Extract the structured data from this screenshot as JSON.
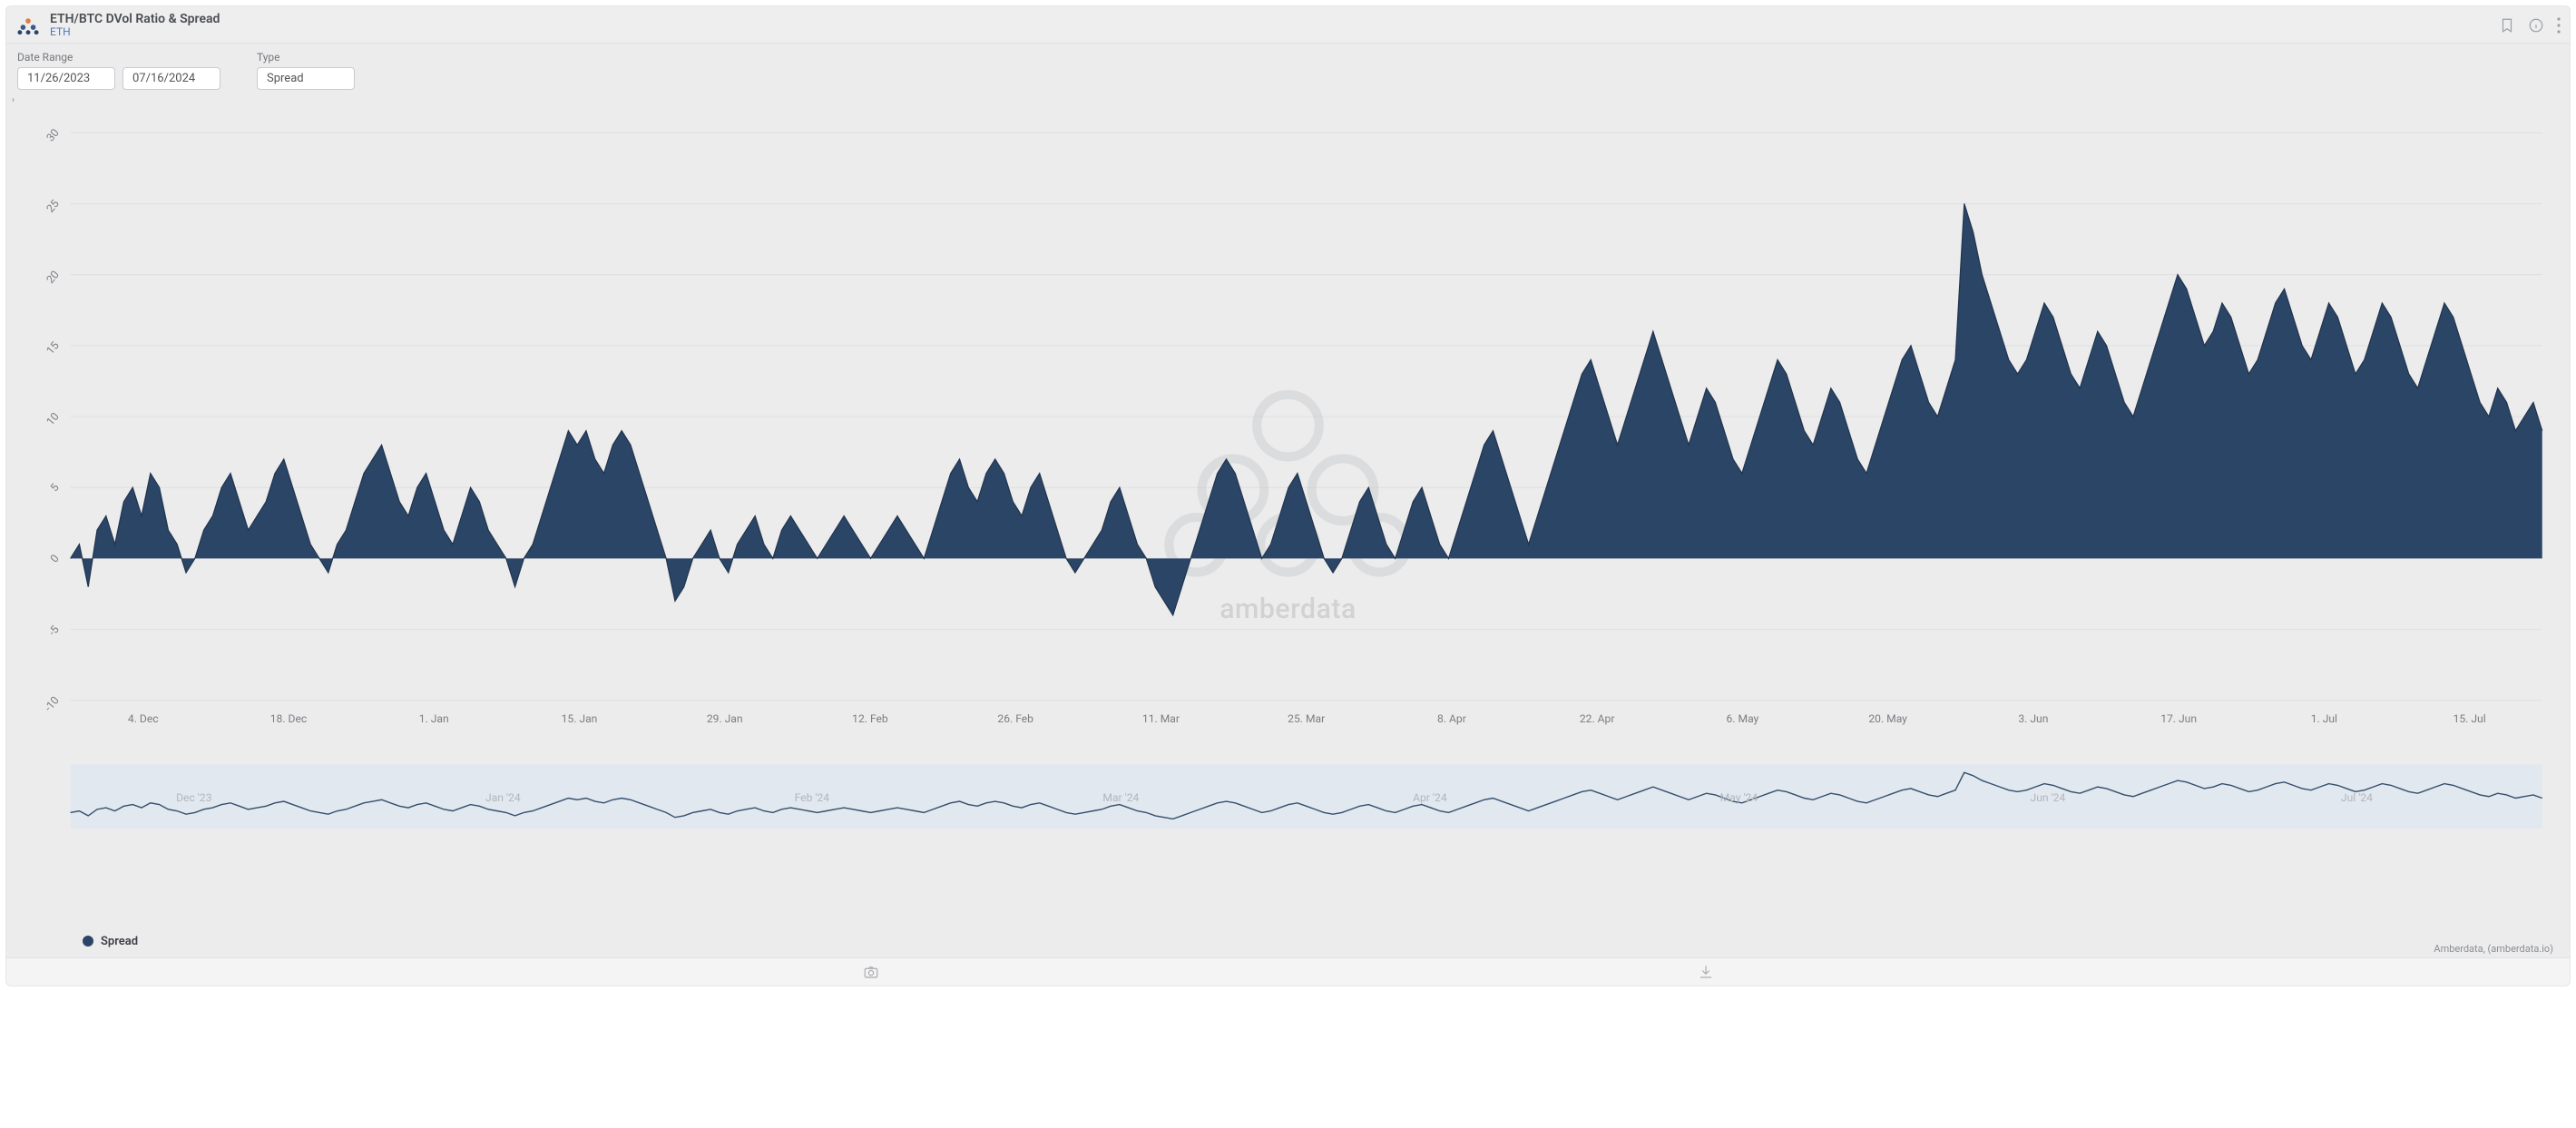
{
  "header": {
    "title": "ETH/BTC DVol Ratio & Spread",
    "subtitle": "ETH"
  },
  "controls": {
    "date_range_label": "Date Range",
    "date_start": "11/26/2023",
    "date_end": "07/16/2024",
    "type_label": "Type",
    "type_value": "Spread"
  },
  "legend": {
    "series_name": "Spread"
  },
  "credit": "Amberdata, (amberdata.io)",
  "watermark": "amberdata",
  "chart_data": {
    "type": "area",
    "ylabel": "",
    "xlabel": "",
    "ylim": [
      -10,
      30
    ],
    "y_ticks": [
      -10,
      -5,
      0,
      5,
      10,
      15,
      20,
      25,
      30
    ],
    "x_ticks": [
      "4. Dec",
      "18. Dec",
      "1. Jan",
      "15. Jan",
      "29. Jan",
      "12. Feb",
      "26. Feb",
      "11. Mar",
      "25. Mar",
      "8. Apr",
      "22. Apr",
      "6. May",
      "20. May",
      "3. Jun",
      "17. Jun",
      "1. Jul",
      "15. Jul"
    ],
    "nav_ticks": [
      "Dec '23",
      "Jan '24",
      "Feb '24",
      "Mar '24",
      "Apr '24",
      "May '24",
      "Jun '24",
      "Jul '24"
    ],
    "series": [
      {
        "name": "Spread",
        "color": "#2b4566",
        "values": [
          0,
          1,
          -2,
          2,
          3,
          1,
          4,
          5,
          3,
          6,
          5,
          2,
          1,
          -1,
          0,
          2,
          3,
          5,
          6,
          4,
          2,
          3,
          4,
          6,
          7,
          5,
          3,
          1,
          0,
          -1,
          1,
          2,
          4,
          6,
          7,
          8,
          6,
          4,
          3,
          5,
          6,
          4,
          2,
          1,
          3,
          5,
          4,
          2,
          1,
          0,
          -2,
          0,
          1,
          3,
          5,
          7,
          9,
          8,
          9,
          7,
          6,
          8,
          9,
          8,
          6,
          4,
          2,
          0,
          -3,
          -2,
          0,
          1,
          2,
          0,
          -1,
          1,
          2,
          3,
          1,
          0,
          2,
          3,
          2,
          1,
          0,
          1,
          2,
          3,
          2,
          1,
          0,
          1,
          2,
          3,
          2,
          1,
          0,
          2,
          4,
          6,
          7,
          5,
          4,
          6,
          7,
          6,
          4,
          3,
          5,
          6,
          4,
          2,
          0,
          -1,
          0,
          1,
          2,
          4,
          5,
          3,
          1,
          0,
          -2,
          -3,
          -4,
          -2,
          0,
          2,
          4,
          6,
          7,
          6,
          4,
          2,
          0,
          1,
          3,
          5,
          6,
          4,
          2,
          0,
          -1,
          0,
          2,
          4,
          5,
          3,
          1,
          0,
          2,
          4,
          5,
          3,
          1,
          0,
          2,
          4,
          6,
          8,
          9,
          7,
          5,
          3,
          1,
          3,
          5,
          7,
          9,
          11,
          13,
          14,
          12,
          10,
          8,
          10,
          12,
          14,
          16,
          14,
          12,
          10,
          8,
          10,
          12,
          11,
          9,
          7,
          6,
          8,
          10,
          12,
          14,
          13,
          11,
          9,
          8,
          10,
          12,
          11,
          9,
          7,
          6,
          8,
          10,
          12,
          14,
          15,
          13,
          11,
          10,
          12,
          14,
          25,
          23,
          20,
          18,
          16,
          14,
          13,
          14,
          16,
          18,
          17,
          15,
          13,
          12,
          14,
          16,
          15,
          13,
          11,
          10,
          12,
          14,
          16,
          18,
          20,
          19,
          17,
          15,
          16,
          18,
          17,
          15,
          13,
          14,
          16,
          18,
          19,
          17,
          15,
          14,
          16,
          18,
          17,
          15,
          13,
          14,
          16,
          18,
          17,
          15,
          13,
          12,
          14,
          16,
          18,
          17,
          15,
          13,
          11,
          10,
          12,
          11,
          9,
          10,
          11,
          9
        ]
      }
    ]
  }
}
